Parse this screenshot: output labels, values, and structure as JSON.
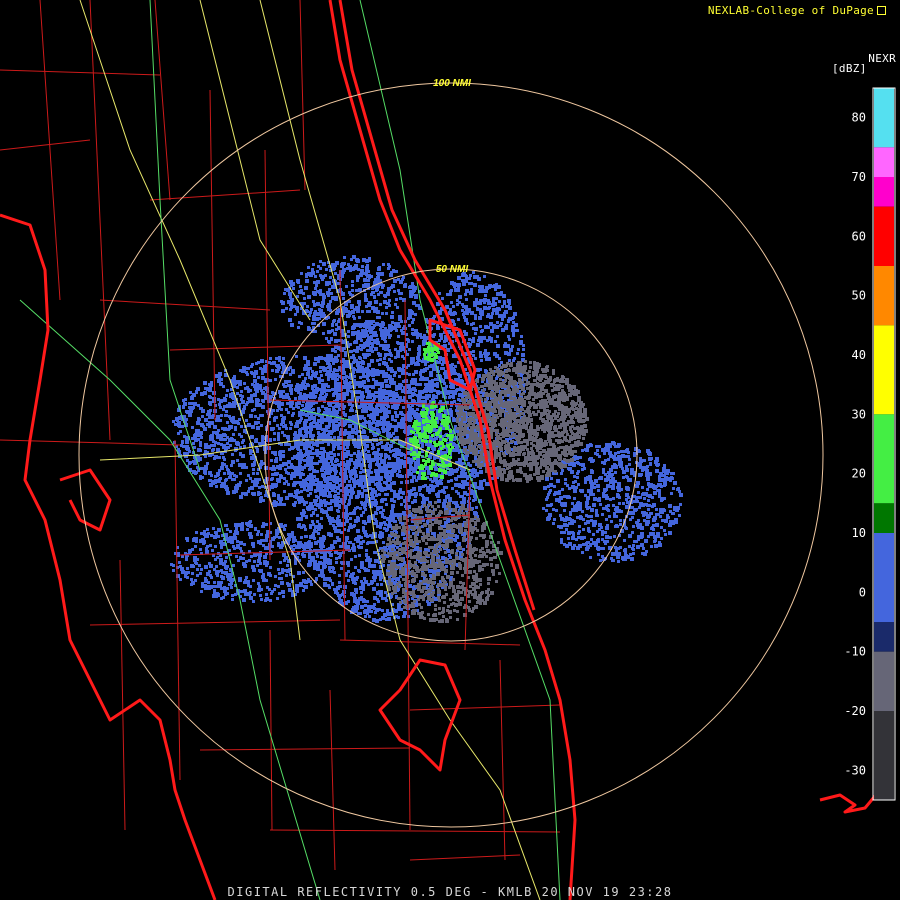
{
  "header": {
    "credit": "NEXLAB-College of DuPage",
    "product_code": "NEXR",
    "units": "[dBZ]"
  },
  "range_rings": [
    {
      "label": "100 NMI"
    },
    {
      "label": "50 NMI"
    }
  ],
  "legend": {
    "ticks": [
      "80",
      "70",
      "60",
      "50",
      "40",
      "30",
      "20",
      "10",
      "0",
      "-10",
      "-20",
      "-30"
    ],
    "colors": {
      "above_75": "#55e0f0",
      "pink": "#ff66ff",
      "magenta": "#ff00cc",
      "red": "#ff0000",
      "orange": "#ff8800",
      "yellow": "#ffff00",
      "green_light": "#44ee44",
      "green_dark": "#007700",
      "blue": "#4466dd",
      "navy": "#1a2a6a",
      "gray": "#666677",
      "dark_gray": "#333338"
    }
  },
  "map_colors": {
    "coastline": "#ff1a1a",
    "county_borders": "#cc1a1a",
    "roads": "#e8e86a",
    "highways": "#55dd66",
    "range_ring": "#f0c8a0"
  },
  "footer": {
    "caption": "DIGITAL REFLECTIVITY 0.5 DEG - KMLB 20 NOV 19 23:28"
  }
}
